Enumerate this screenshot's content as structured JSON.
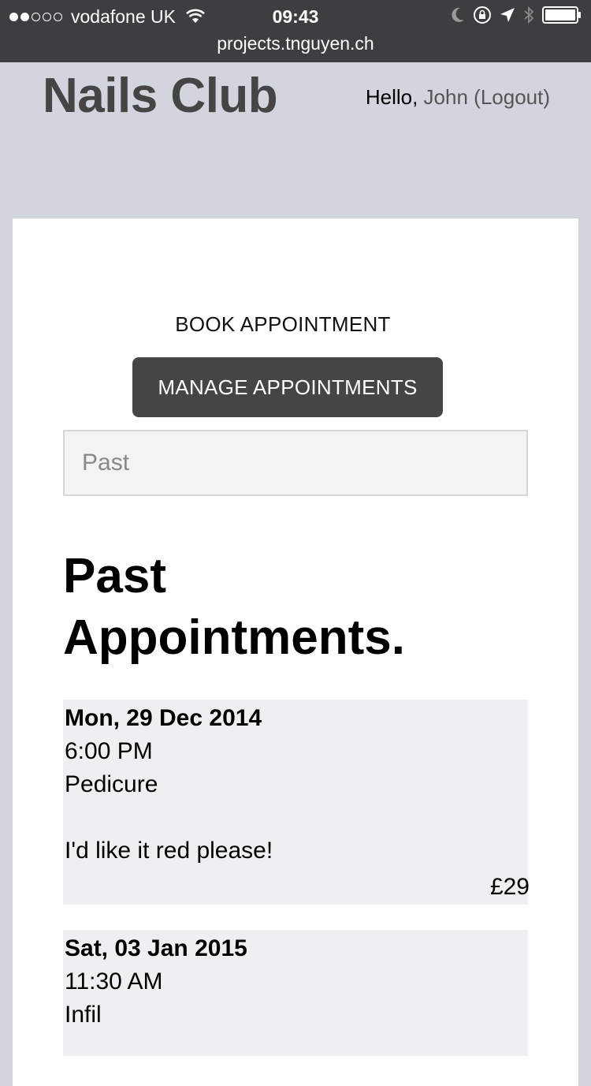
{
  "status_bar": {
    "carrier": "vodafone UK",
    "time": "09:43",
    "url": "projects.tnguyen.ch",
    "signal_bars_filled": 2,
    "signal_bars_total": 5
  },
  "header": {
    "brand": "Nails Club",
    "greeting_prefix": "Hello, ",
    "user_name": "John",
    "logout_label": "(Logout)"
  },
  "nav": {
    "book_label": "BOOK APPOINTMENT",
    "manage_label": "MANAGE APPOINTMENTS"
  },
  "filter": {
    "value": "Past"
  },
  "section": {
    "title_line1": "Past",
    "title_line2": "Appointments."
  },
  "appointments": [
    {
      "date": "Mon, 29 Dec 2014",
      "time": "6:00 PM",
      "service": "Pedicure",
      "note": "I'd like it red please!",
      "price": "£29"
    },
    {
      "date": "Sat, 03 Jan 2015",
      "time": "11:30 AM",
      "service": "Infil"
    }
  ],
  "colors": {
    "page_bg": "#d2d5dd",
    "status_bar_bg": "#3d3e40",
    "button_bg": "#454545",
    "card_bg": "#ffffff",
    "appointment_bg": "#efeff1"
  }
}
